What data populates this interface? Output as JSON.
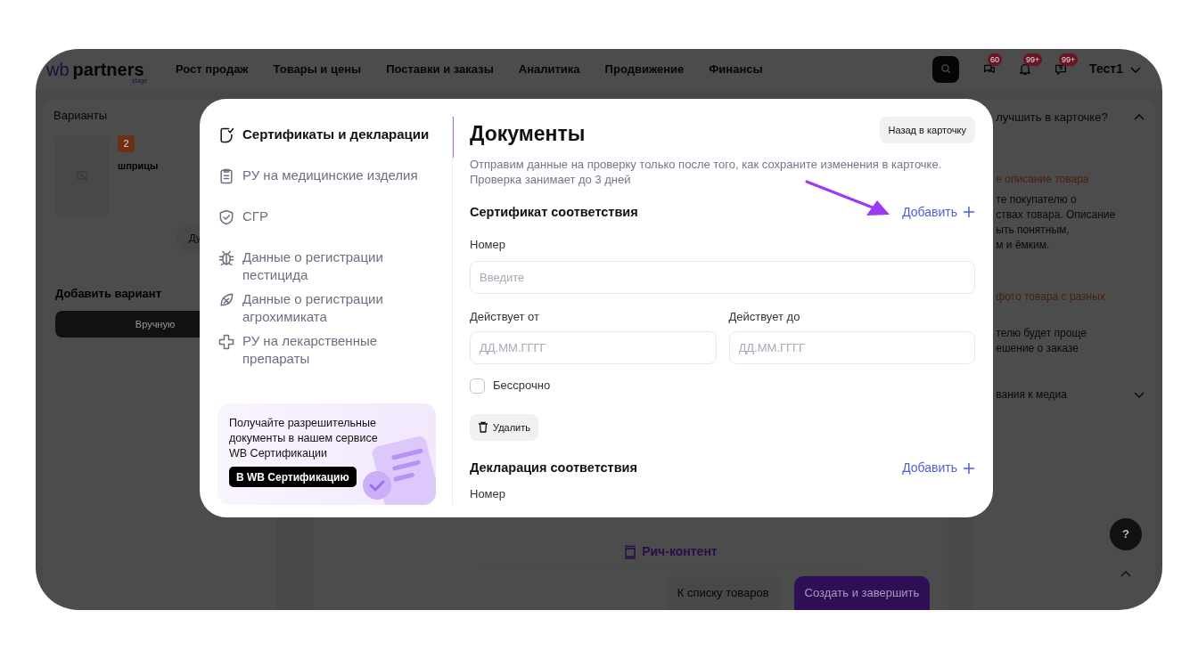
{
  "header": {
    "logo": {
      "mark": "wb",
      "name": "partners",
      "sub": "stage"
    },
    "nav": [
      "Рост продаж",
      "Товары и цены",
      "Поставки и заказы",
      "Аналитика",
      "Продвижение",
      "Финансы"
    ],
    "notifications": [
      {
        "kind": "chat",
        "count": "60"
      },
      {
        "kind": "bell",
        "count": "99+"
      },
      {
        "kind": "help",
        "count": "99+"
      }
    ],
    "user": "Тест1"
  },
  "variants_panel": {
    "title": "Варианты",
    "badge": "2",
    "name": "шприцы",
    "chip": "Ду",
    "add_title": "Добавить вариант",
    "manual_button": "Вручную"
  },
  "help_button": "?",
  "content_panel": {
    "rich_content": "Рич-контент",
    "back_button": "К списку товаров",
    "finish_button": "Создать и завершить"
  },
  "tips_panel": {
    "title": "лучшить в карточке?",
    "tips": [
      {
        "heading": "е описание товара",
        "lines": [
          "те покупателю о",
          "ствах товара. Описание",
          "ыть понятным,",
          "м и ёмким."
        ]
      },
      {
        "heading": "фото товара с разных",
        "lines": [
          "телю будет проще",
          "ешение о заказе"
        ]
      }
    ],
    "media_title": "вания к медиа"
  },
  "modal": {
    "nav": [
      {
        "kind": "certificate",
        "label": "Сертификаты и декларации",
        "selected": true
      },
      {
        "kind": "clipboard",
        "label": "РУ на медицинские изделия",
        "selected": false
      },
      {
        "kind": "shield",
        "label": "СГР",
        "selected": false
      },
      {
        "kind": "bug",
        "label": "Данные о регистрации пестицида",
        "selected": false
      },
      {
        "kind": "leaf",
        "label": "Данные о регистрации агрохимиката",
        "selected": false
      },
      {
        "kind": "cross",
        "label": "РУ на лекарственные препараты",
        "selected": false
      }
    ],
    "promo": {
      "text": "Получайте разрешительные документы в нашем сервисе WB Сертификации",
      "button": "В WB Сертификацию"
    },
    "title": "Документы",
    "back_button": "Назад в карточку",
    "description": "Отправим данные на проверку только после того, как сохраните изменения в карточке. Проверка занимает до 3 дней",
    "certificate": {
      "title": "Сертификат соответствия",
      "add": "Добавить",
      "number_label": "Номер",
      "number_placeholder": "Введите",
      "from_label": "Действует от",
      "from_placeholder": "ДД.ММ.ГГГГ",
      "to_label": "Действует до",
      "to_placeholder": "ДД.ММ.ГГГГ",
      "perpetual": {
        "label": "Бессрочно",
        "checked": false
      },
      "delete": "Удалить"
    },
    "declaration": {
      "title": "Декларация соответствия",
      "add": "Добавить",
      "number_label": "Номер"
    }
  }
}
